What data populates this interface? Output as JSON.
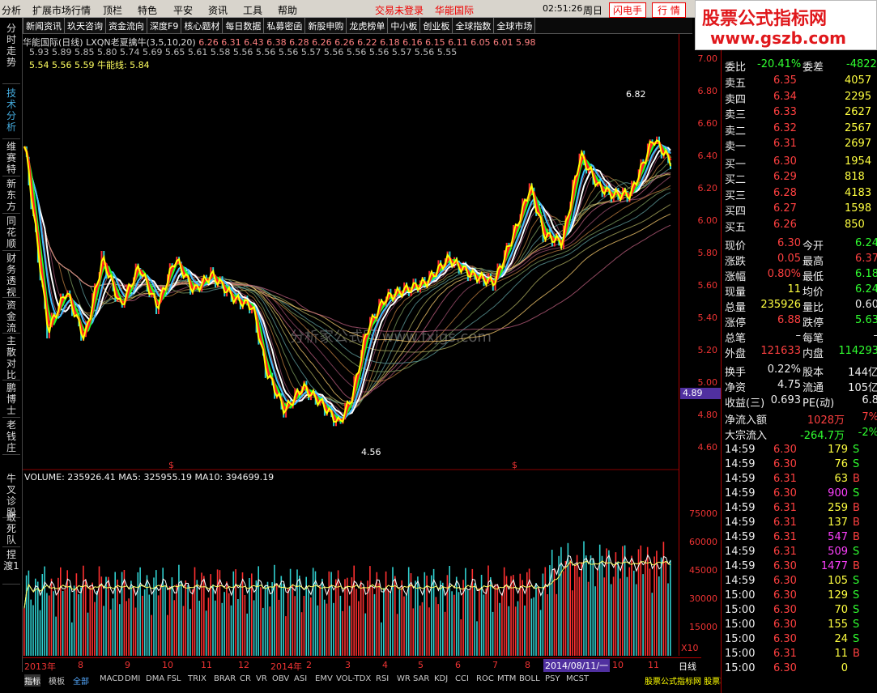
{
  "menubar": {
    "items": [
      "分析",
      "扩展市场行情",
      "顶栏",
      "特色",
      "平安",
      "资讯",
      "工具",
      "帮助"
    ],
    "trade_status": "交易未登录",
    "broker": "华能国际",
    "time": "02:51:26",
    "weekday": "周日",
    "flash": "闪电手",
    "quote": "行 情"
  },
  "logo": {
    "line1": "股票公式指标网",
    "line2": "www.gszb.com"
  },
  "toolbar": [
    "资讯",
    "新闻资讯",
    "玖天咨询",
    "资金流向",
    "深度F9",
    "核心题材",
    "每日数据",
    "私募密函",
    "新股申购",
    "龙虎榜单",
    "中小板",
    "创业板",
    "全球指数",
    "全球市场"
  ],
  "lefttabs": [
    "分时走势",
    "技术分析",
    "维赛特",
    "新东方",
    "同花顺",
    "财务透视",
    "资金流",
    "主散对比",
    "鹏博士",
    "老钱庄",
    "牛叉诊股",
    "敢死队",
    "捏渡1"
  ],
  "chart": {
    "title": "华能国际(日线) LXQN老夏擒牛(3,5,10,20)",
    "row1": "6.26  6.31  6.43  6.38  6.28  6.26  6.26  6.22  6.18  6.16  6.15  6.11  6.05  6.01  5.98",
    "row2": "5.93  5.89  5.85  5.80  5.74  5.69  5.65  5.61  5.58  5.56  5.56  5.56  5.57  5.56  5.56  5.56  5.57  5.56  5.55",
    "row3": "5.54  5.56  5.59 牛能线: 5.84",
    "high_label": "6.82",
    "low_label": "4.56",
    "current_price": "4.89",
    "watermark": "分析家公式网 www.fxjgs.com",
    "period": "日线",
    "yaxis": [
      "7.00",
      "6.80",
      "6.60",
      "6.40",
      "6.20",
      "6.00",
      "5.80",
      "5.60",
      "5.40",
      "5.20",
      "5.00",
      "4.80",
      "4.60"
    ],
    "marker": "$"
  },
  "volume": {
    "header": "VOLUME: 235926.41  MA5: 325955.19  MA10: 394699.19",
    "yaxis": [
      "75000",
      "60000",
      "45000",
      "30000",
      "15000"
    ],
    "unit": "X10"
  },
  "xaxis": {
    "labels": [
      "2013年",
      "8",
      "9",
      "10",
      "11",
      "12",
      "2014年",
      "2",
      "3",
      "4",
      "5",
      "6",
      "7",
      "8",
      "9",
      "10",
      "11"
    ],
    "cursor_date": "2014/08/11/一"
  },
  "bottomtabs": [
    "指标",
    "模板",
    "全部",
    "MACD",
    "DMI",
    "DMA",
    "FSL",
    "TRIX",
    "BRAR",
    "CR",
    "VR",
    "OBV",
    "ASI",
    "EMV",
    "VOL-TDX",
    "RSI",
    "WR",
    "SAR",
    "KDJ",
    "CCI",
    "ROC",
    "MTM",
    "BOLL",
    "PSY",
    "MCST"
  ],
  "bottom_ad": "股票公式指标网 股票软件下载 分析家 大智慧 通达信",
  "panel": {
    "weibi_label": "委比",
    "weibi": "-20.41%",
    "weicha_label": "委差",
    "weicha": "-4822",
    "sells": [
      {
        "l": "卖五",
        "p": "6.35",
        "v": "4057"
      },
      {
        "l": "卖四",
        "p": "6.34",
        "v": "2295"
      },
      {
        "l": "卖三",
        "p": "6.33",
        "v": "2627"
      },
      {
        "l": "卖二",
        "p": "6.32",
        "v": "2567"
      },
      {
        "l": "卖一",
        "p": "6.31",
        "v": "2697"
      }
    ],
    "buys": [
      {
        "l": "买一",
        "p": "6.30",
        "v": "1954"
      },
      {
        "l": "买二",
        "p": "6.29",
        "v": "818"
      },
      {
        "l": "买三",
        "p": "6.28",
        "v": "4183"
      },
      {
        "l": "买四",
        "p": "6.27",
        "v": "1598"
      },
      {
        "l": "买五",
        "p": "6.26",
        "v": "850"
      }
    ],
    "stats": [
      {
        "a": "现价",
        "av": "6.30",
        "b": "今开",
        "bv": "6.24"
      },
      {
        "a": "涨跌",
        "av": "0.05",
        "b": "最高",
        "bv": "6.37"
      },
      {
        "a": "涨幅",
        "av": "0.80%",
        "b": "最低",
        "bv": "6.18"
      },
      {
        "a": "现量",
        "av": "11",
        "b": "均价",
        "bv": "6.24"
      },
      {
        "a": "总量",
        "av": "235926",
        "b": "量比",
        "bv": "0.60"
      },
      {
        "a": "涨停",
        "av": "6.88",
        "b": "跌停",
        "bv": "5.63"
      },
      {
        "a": "总笔",
        "av": "–",
        "b": "每笔",
        "bv": "–"
      },
      {
        "a": "外盘",
        "av": "121633",
        "b": "内盘",
        "bv": "114293"
      }
    ],
    "stats2": [
      {
        "a": "换手",
        "av": "0.22%",
        "b": "股本",
        "bv": "144亿"
      },
      {
        "a": "净资",
        "av": "4.75",
        "b": "流通",
        "bv": "105亿"
      },
      {
        "a": "收益(三)",
        "av": "0.693",
        "b": "PE(动)",
        "bv": "6.8"
      }
    ],
    "flow": [
      {
        "a": "净流入额",
        "av": "1028万",
        "bv": "7%"
      },
      {
        "a": "大宗流入",
        "av": "-264.7万",
        "bv": "-2%"
      }
    ],
    "ticks": [
      [
        "14:59",
        "6.30",
        "179",
        "S"
      ],
      [
        "14:59",
        "6.30",
        "76",
        "S"
      ],
      [
        "14:59",
        "6.31",
        "63",
        "B"
      ],
      [
        "14:59",
        "6.30",
        "900",
        "S"
      ],
      [
        "14:59",
        "6.31",
        "259",
        "B"
      ],
      [
        "14:59",
        "6.31",
        "137",
        "B"
      ],
      [
        "14:59",
        "6.31",
        "547",
        "B"
      ],
      [
        "14:59",
        "6.31",
        "509",
        "S"
      ],
      [
        "14:59",
        "6.30",
        "1477",
        "B"
      ],
      [
        "14:59",
        "6.30",
        "105",
        "S"
      ],
      [
        "15:00",
        "6.30",
        "129",
        "S"
      ],
      [
        "15:00",
        "6.30",
        "70",
        "S"
      ],
      [
        "15:00",
        "6.30",
        "155",
        "S"
      ],
      [
        "15:00",
        "6.30",
        "24",
        "S"
      ],
      [
        "15:00",
        "6.31",
        "11",
        "B"
      ],
      [
        "15:00",
        "6.30",
        "0",
        ""
      ]
    ]
  },
  "colors": {
    "up": "#ff3030",
    "down": "#30e0e0",
    "axis": "#aa0000",
    "ma_green": "#20ff20",
    "ma_yellow": "#ffff00",
    "ma_red": "#ff2020",
    "ma_white": "#ffffff"
  }
}
